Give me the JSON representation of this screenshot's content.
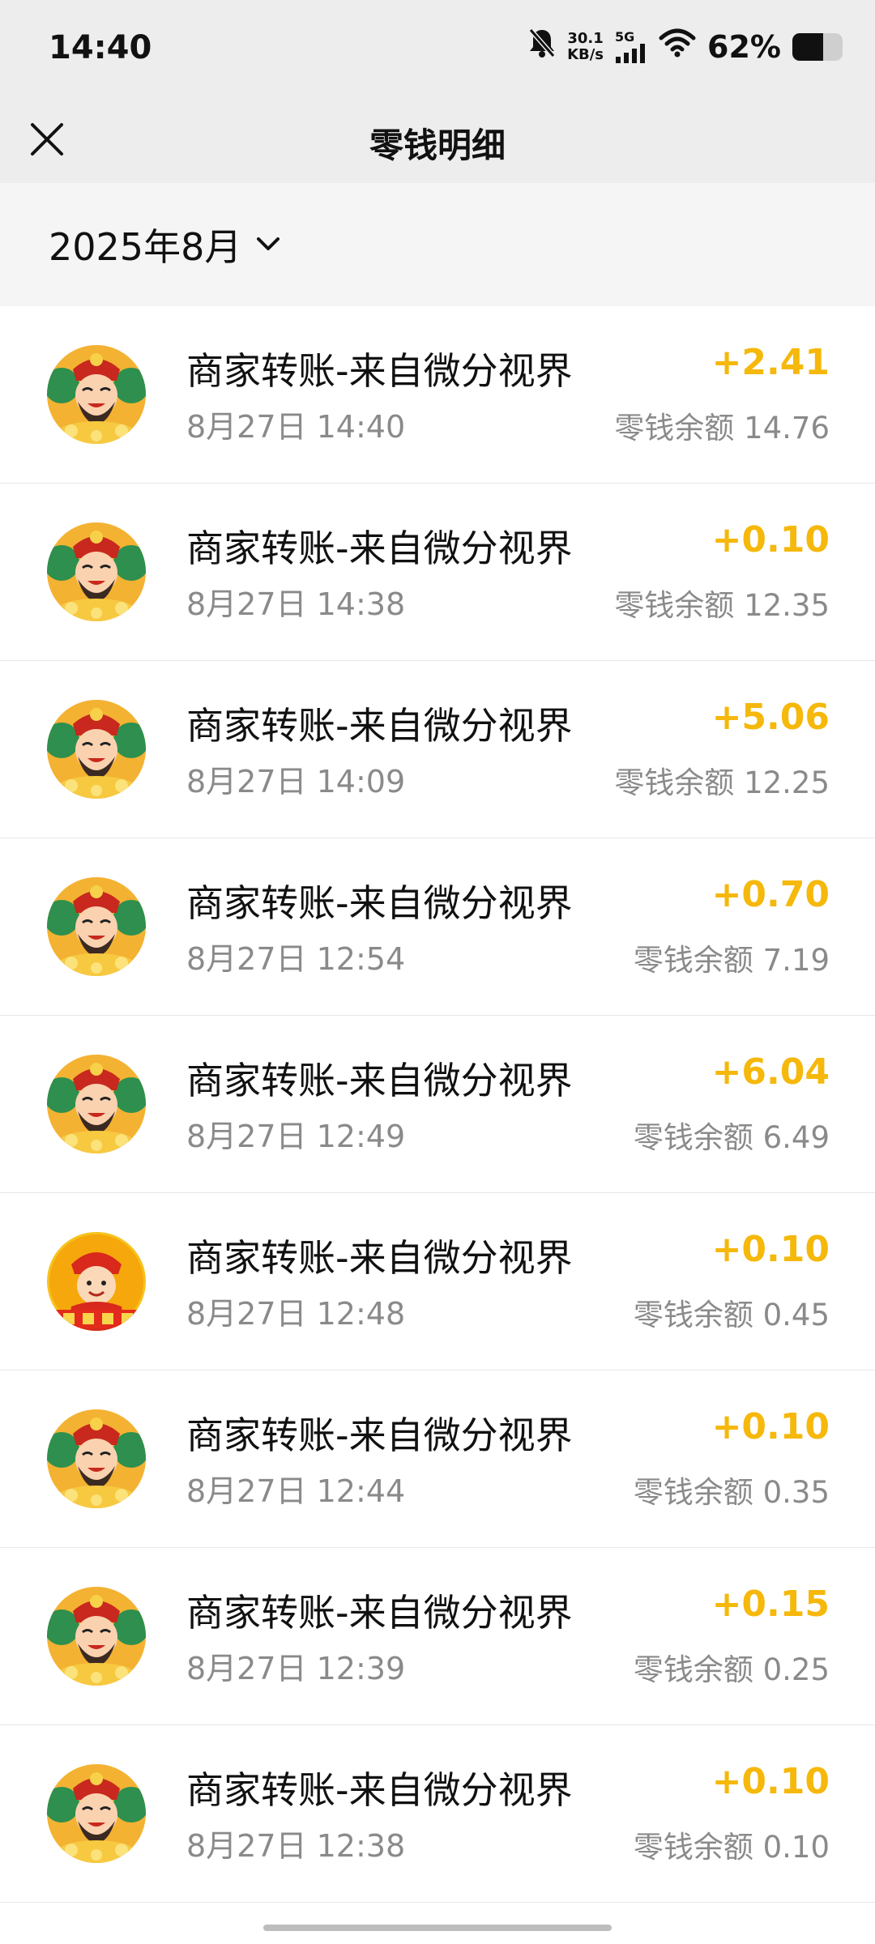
{
  "status_bar": {
    "time": "14:40",
    "net_speed_value": "30.1",
    "net_speed_unit": "KB/s",
    "network": "5G",
    "battery": "62%",
    "battery_level": 0.62,
    "icons": [
      "bell-muted-icon",
      "signal-icon",
      "wifi-icon",
      "battery-icon"
    ]
  },
  "header": {
    "title": "零钱明细",
    "close_icon": "close-icon"
  },
  "filter": {
    "month": "2025年8月",
    "dropdown_icon": "chevron-down-icon"
  },
  "transactions": [
    {
      "title": "商家转账-来自微分视界",
      "time": "8月27日 14:40",
      "amount": "+2.41",
      "balance": "零钱余额 14.76",
      "avatar": "god-of-wealth-avatar"
    },
    {
      "title": "商家转账-来自微分视界",
      "time": "8月27日 14:38",
      "amount": "+0.10",
      "balance": "零钱余额 12.35",
      "avatar": "god-of-wealth-avatar"
    },
    {
      "title": "商家转账-来自微分视界",
      "time": "8月27日 14:09",
      "amount": "+5.06",
      "balance": "零钱余额 12.25",
      "avatar": "god-of-wealth-avatar"
    },
    {
      "title": "商家转账-来自微分视界",
      "time": "8月27日 12:54",
      "amount": "+0.70",
      "balance": "零钱余额 7.19",
      "avatar": "god-of-wealth-avatar"
    },
    {
      "title": "商家转账-来自微分视界",
      "time": "8月27日 12:49",
      "amount": "+6.04",
      "balance": "零钱余额 6.49",
      "avatar": "god-of-wealth-avatar"
    },
    {
      "title": "商家转账-来自微分视界",
      "time": "8月27日 12:48",
      "amount": "+0.10",
      "balance": "零钱余额 0.45",
      "avatar": "fortune-boy-avatar"
    },
    {
      "title": "商家转账-来自微分视界",
      "time": "8月27日 12:44",
      "amount": "+0.10",
      "balance": "零钱余额 0.35",
      "avatar": "god-of-wealth-avatar"
    },
    {
      "title": "商家转账-来自微分视界",
      "time": "8月27日 12:39",
      "amount": "+0.15",
      "balance": "零钱余额 0.25",
      "avatar": "god-of-wealth-avatar"
    },
    {
      "title": "商家转账-来自微分视界",
      "time": "8月27日 12:38",
      "amount": "+0.10",
      "balance": "零钱余额 0.10",
      "avatar": "god-of-wealth-avatar"
    }
  ],
  "colors": {
    "amount": "#f5b80b",
    "secondary_text": "#8a8a8a",
    "header_bg": "#ededed",
    "filter_bg": "#f5f5f5"
  }
}
